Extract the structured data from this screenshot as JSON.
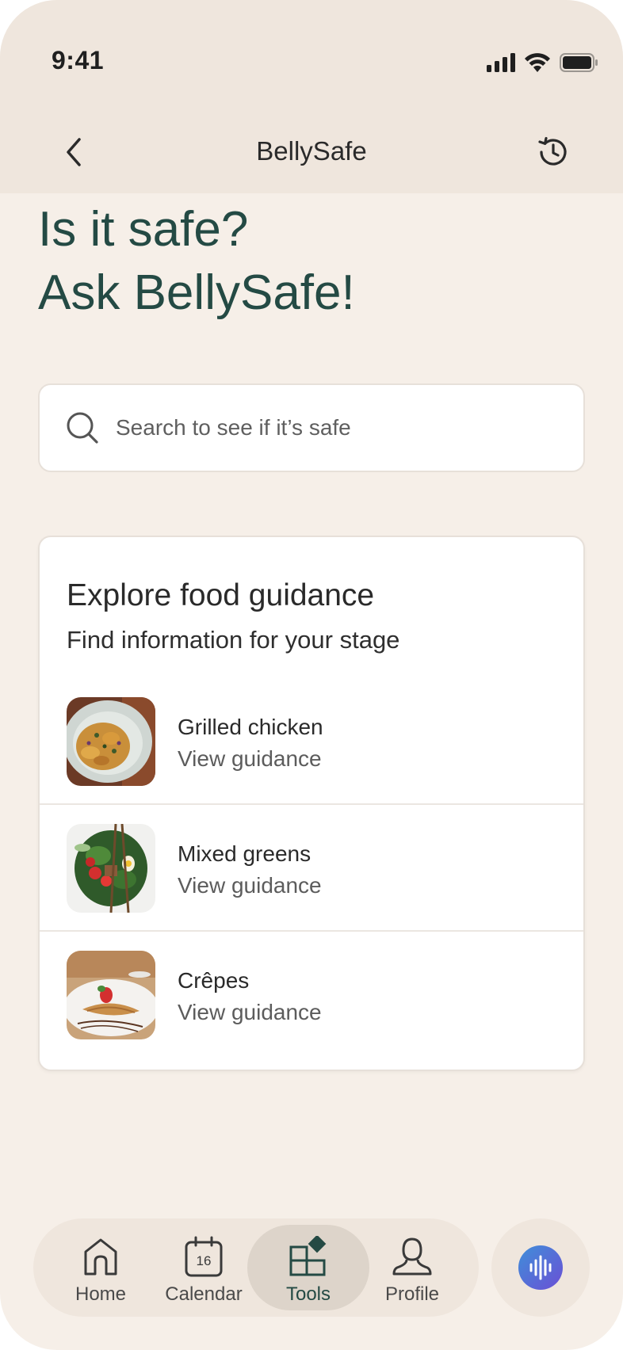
{
  "status_bar": {
    "time": "9:41"
  },
  "nav": {
    "title": "BellySafe"
  },
  "hero": {
    "line1": "Is it safe?",
    "line2": "Ask BellySafe!"
  },
  "search": {
    "placeholder": "Search to see if it’s safe"
  },
  "guidance": {
    "title": "Explore food guidance",
    "subtitle": "Find information for your stage",
    "items": [
      {
        "name": "Grilled chicken",
        "action": "View guidance",
        "image": "grilled-chicken-photo"
      },
      {
        "name": "Mixed greens",
        "action": "View guidance",
        "image": "mixed-greens-photo"
      },
      {
        "name": "Crêpes",
        "action": "View guidance",
        "image": "crepes-photo"
      }
    ]
  },
  "tabbar": {
    "items": [
      {
        "label": "Home",
        "icon": "home-icon"
      },
      {
        "label": "Calendar",
        "icon": "calendar-icon",
        "badge": "16"
      },
      {
        "label": "Tools",
        "icon": "tools-icon",
        "active": true
      },
      {
        "label": "Profile",
        "icon": "profile-icon"
      }
    ]
  },
  "voice": {
    "icon": "voice-waveform-icon"
  },
  "colors": {
    "accent": "#244a44",
    "background": "#f6efe8",
    "header": "#efe6dd",
    "voice_gradient": [
      "#3f8fd8",
      "#6b4fd6"
    ]
  }
}
